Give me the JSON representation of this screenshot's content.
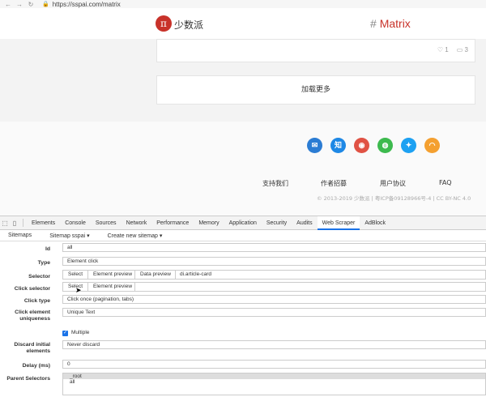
{
  "browser": {
    "back_icon": "←",
    "forward_icon": "→",
    "reload_icon": "↻",
    "lock_icon": "🔒",
    "url": "https://sspai.com/matrix"
  },
  "header": {
    "logo_glyph": "π",
    "logo_text": "少数派",
    "hash": "#",
    "title": "Matrix",
    "brand_color": "#c8322a"
  },
  "card": {
    "likes_icon": "♡",
    "likes": "1",
    "comments_icon": "▭",
    "comments": "3"
  },
  "load_more": "加载更多",
  "footer": {
    "social": [
      {
        "name": "mail-icon",
        "glyph": "✉",
        "color": "#2b7cd3"
      },
      {
        "name": "zhihu-icon",
        "glyph": "知",
        "color": "#1e88e5"
      },
      {
        "name": "weibo-icon",
        "glyph": "◉",
        "color": "#e05244"
      },
      {
        "name": "wechat-icon",
        "glyph": "◍",
        "color": "#3dba4e"
      },
      {
        "name": "twitter-icon",
        "glyph": "✦",
        "color": "#1da1f2"
      },
      {
        "name": "rss-icon",
        "glyph": "◠",
        "color": "#f4a030"
      }
    ],
    "links": [
      "支持我们",
      "作者招募",
      "用户协议",
      "FAQ"
    ],
    "copyright": "© 2013-2019 少数派 | 粤ICP备09128966号-4 | CC BY-NC 4.0"
  },
  "devtools": {
    "inspect_icon": "⬚",
    "device_icon": "▯",
    "tabs": [
      "Elements",
      "Console",
      "Sources",
      "Network",
      "Performance",
      "Memory",
      "Application",
      "Security",
      "Audits",
      "Web Scraper",
      "AdBlock"
    ],
    "active_tab": "Web Scraper",
    "sub_nav": [
      "Sitemaps",
      "Sitemap sspai ▾",
      "Create new sitemap ▾"
    ]
  },
  "form": {
    "id_label": "Id",
    "id_value": "all",
    "type_label": "Type",
    "type_value": "Element click",
    "selector_label": "Selector",
    "selector_buttons": [
      "Select",
      "Element preview",
      "Data preview"
    ],
    "selector_value": "di.article-card",
    "click_selector_label": "Click selector",
    "click_selector_buttons": [
      "Select",
      "Element preview"
    ],
    "click_type_label": "Click type",
    "click_type_value": "Click once (pagination, tabs)",
    "uniqueness_label": "Click element uniqueness",
    "uniqueness_value": "Unique Text",
    "multiple_label": "Multiple",
    "discard_label": "Discard initial elements",
    "discard_value": "Never discard",
    "delay_label": "Delay (ms)",
    "delay_value": "0",
    "parent_label": "Parent Selectors",
    "parent_options": [
      "_root",
      "all"
    ]
  }
}
